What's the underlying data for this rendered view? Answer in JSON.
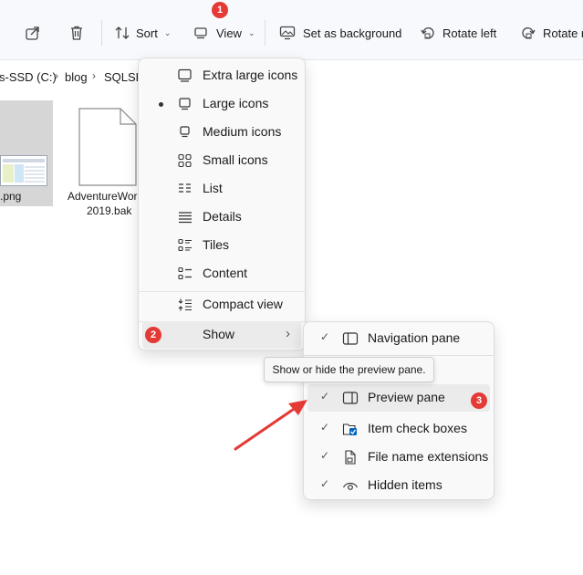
{
  "toolbar": {
    "sort_label": "Sort",
    "view_label": "View",
    "set_background_label": "Set as background",
    "rotate_left_label": "Rotate left",
    "rotate_right_label": "Rotate r"
  },
  "badges": {
    "view": "1",
    "show": "2",
    "preview_pane": "3"
  },
  "address": {
    "drive": "s-SSD (C:)",
    "folder": "blog",
    "subfolder": "SQLSER"
  },
  "files": [
    {
      "name": ".png",
      "icon": "image-thumbnail"
    },
    {
      "name_line1": "AdventureWorl",
      "name_line2": "2019.bak",
      "icon": "document-icon"
    }
  ],
  "view_menu": {
    "items": [
      {
        "label": "Extra large icons",
        "icon": "monitor-icon",
        "selected": false
      },
      {
        "label": "Large icons",
        "icon": "monitor-icon",
        "selected": true
      },
      {
        "label": "Medium icons",
        "icon": "monitor-small-icon",
        "selected": false
      },
      {
        "label": "Small icons",
        "icon": "grid-icon",
        "selected": false
      },
      {
        "label": "List",
        "icon": "list-icon",
        "selected": false
      },
      {
        "label": "Details",
        "icon": "details-icon",
        "selected": false
      },
      {
        "label": "Tiles",
        "icon": "tiles-icon",
        "selected": false
      },
      {
        "label": "Content",
        "icon": "content-icon",
        "selected": false
      },
      {
        "label": "Compact view",
        "icon": "compact-icon",
        "selected": false
      },
      {
        "label": "Show",
        "icon": "",
        "selected": false
      }
    ]
  },
  "show_menu": {
    "items": [
      {
        "label": "Navigation pane",
        "checked": true,
        "icon": "pane-icon"
      },
      {
        "label": "Preview pane",
        "checked": true,
        "icon": "pane-icon"
      },
      {
        "label": "Item check boxes",
        "checked": true,
        "icon": "checkbox-folder-icon"
      },
      {
        "label": "File name extensions",
        "checked": true,
        "icon": "file-icon"
      },
      {
        "label": "Hidden items",
        "checked": true,
        "icon": "eye-icon"
      }
    ]
  },
  "tooltip": "Show or hide the preview pane.",
  "colors": {
    "badge": "#e53935",
    "arrow": "#e53935",
    "accent": "#0067c0",
    "toolbar_bg": "#f7f9fc"
  }
}
